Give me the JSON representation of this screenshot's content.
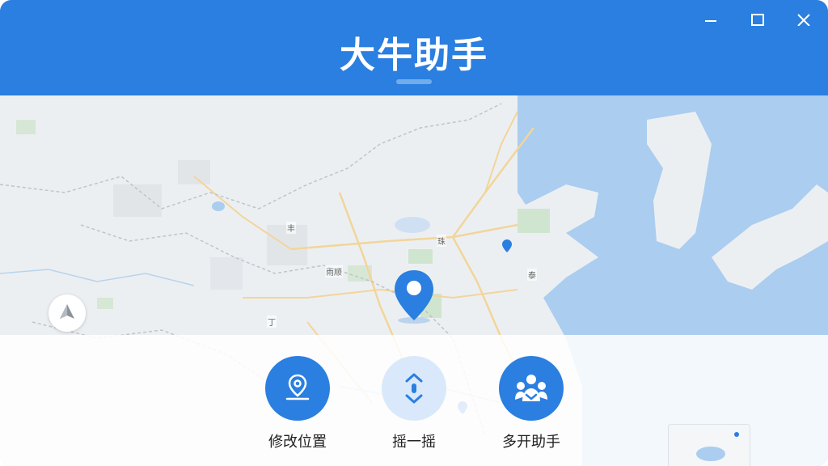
{
  "window": {
    "title": "大牛助手",
    "controls": [
      "minimize",
      "maximize",
      "close"
    ]
  },
  "map": {
    "labels": [
      "丰",
      "雨顺",
      "珠",
      "泰",
      "丁"
    ],
    "compass_icon": "location-compass-icon",
    "pins": [
      "map-pin-icon",
      "small-pin-icon",
      "small-pin-icon"
    ]
  },
  "actions": [
    {
      "label": "修改位置",
      "icon": "location-pin-icon"
    },
    {
      "label": "摇一摇",
      "icon": "shake-icon"
    },
    {
      "label": "多开助手",
      "icon": "multi-user-icon"
    }
  ],
  "colors": {
    "brand": "#2a7fe0",
    "light_accent": "#d9e9fb",
    "sea": "#aacdf0"
  }
}
